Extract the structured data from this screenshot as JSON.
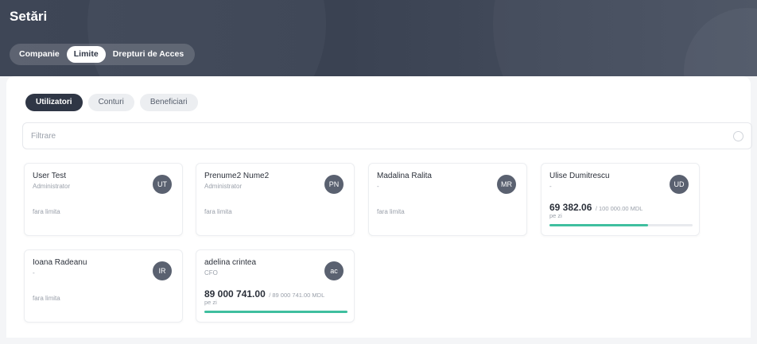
{
  "header": {
    "title": "Setări",
    "tabs": [
      {
        "label": "Companie",
        "active": false
      },
      {
        "label": "Limite",
        "active": true
      },
      {
        "label": "Drepturi de Acces",
        "active": false
      }
    ]
  },
  "sub_tabs": [
    {
      "label": "Utilizatori",
      "active": true
    },
    {
      "label": "Conturi",
      "active": false
    },
    {
      "label": "Beneficiari",
      "active": false
    }
  ],
  "filter": {
    "placeholder": "Filtrare"
  },
  "users": [
    {
      "name": "User Test",
      "role": "Administrator",
      "initials": "UT",
      "limit": "fara limita"
    },
    {
      "name": "Prenume2 Nume2",
      "role": "Administrator",
      "initials": "PN",
      "limit": "fara limita"
    },
    {
      "name": "Madalina Ralita",
      "role": "-",
      "initials": "MR",
      "limit": "fara limita"
    },
    {
      "name": "Ulise Dumitrescu",
      "role": "-",
      "initials": "UD",
      "amount": "69 382.06",
      "amount_total": "/ 100 000.00 MDL",
      "period": "pe zi",
      "progress": 0.69
    },
    {
      "name": "Ioana Radeanu",
      "role": "-",
      "initials": "IR",
      "limit": "fara limita"
    },
    {
      "name": "adelina crintea",
      "role": "CFO",
      "initials": "ac",
      "amount": "89 000 741.00",
      "amount_total": "/ 89 000 741.00 MDL",
      "period": "pe zi",
      "progress": 1.0
    }
  ],
  "colors": {
    "header_bg": "#3e4656",
    "active_tab": "#2f3645",
    "progress": "#3fbf9f",
    "avatar": "#5a6170"
  }
}
